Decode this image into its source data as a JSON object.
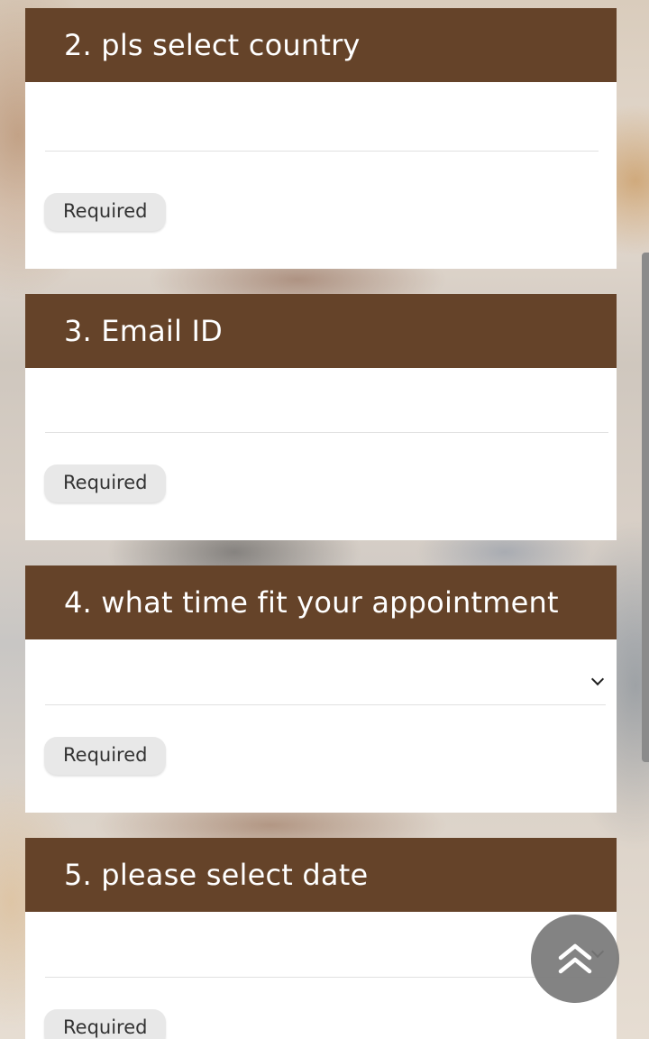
{
  "questions": [
    {
      "title": "2. pls select country",
      "value": "",
      "badge": "Required",
      "type": "text"
    },
    {
      "title": "3. Email ID",
      "value": "",
      "badge": "Required",
      "type": "text"
    },
    {
      "title": "4. what time fit your appointment",
      "value": "",
      "badge": "Required",
      "type": "dropdown"
    },
    {
      "title": "5. please select date",
      "value": "",
      "badge": "Required",
      "type": "dropdown"
    }
  ],
  "icons": {
    "dropdown": "chevron-down-icon",
    "scroll_top": "double-chevron-up-icon"
  },
  "colors": {
    "header_bg": "#654329",
    "header_text": "#ffffff",
    "badge_bg": "#e8e8e8",
    "fab_bg": "#787878"
  }
}
